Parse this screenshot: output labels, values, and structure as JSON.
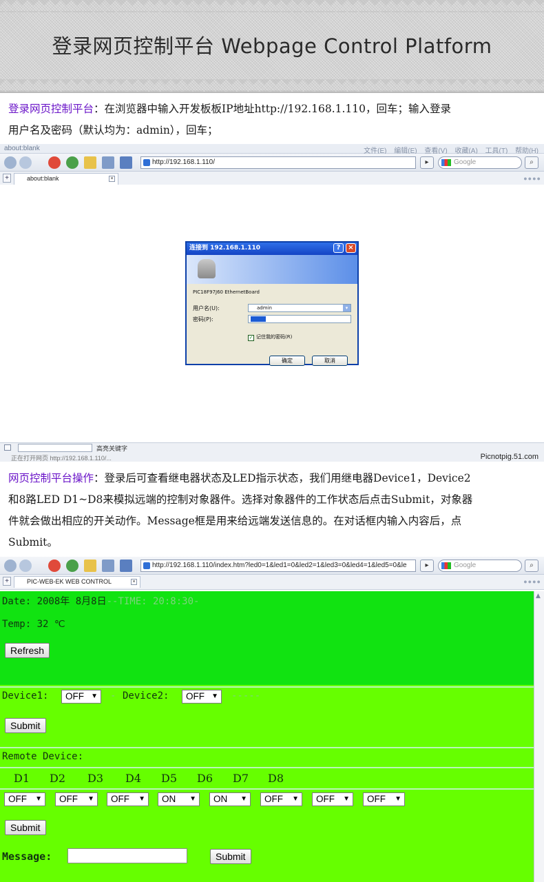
{
  "banner": {
    "title": "登录网页控制平台 Webpage Control Platform"
  },
  "para1": {
    "highlight": "登录网页控制平台",
    "line1_rest": "：在浏览器中输入开发板板IP地址http://192.168.1.110，回车；输入登录",
    "line2": "用户名及密码（默认均为：admin），回车；"
  },
  "browser1": {
    "tab_title": "about:blank",
    "menu": "文件(E) 编辑(E) 查看(V) 收藏(A) 工具(T) 帮助(H)",
    "address": "http://192.168.1.110/",
    "search_placeholder": "Google",
    "tab_label": "about:blank"
  },
  "login_dialog": {
    "title": "连接到 192.168.1.110",
    "server": "PIC18F97J60 EthernetBoard",
    "username_label": "用户名(U):",
    "username_value": "admin",
    "password_label": "密码(P):",
    "remember_label": "记住我的密码(R)",
    "ok_label": "确定",
    "cancel_label": "取消"
  },
  "statusbar": {
    "highlight_label": "高亮关键字",
    "opening": "正在打开网页 http://192.168.1.110/...",
    "watermark": "Picnotpig.51.com"
  },
  "para2": {
    "highlight": "网页控制平台操作",
    "line1_rest": "：登录后可查看继电器状态及LED指示状态，我们用继电器Device1，Device2",
    "line2": "和8路LED D1~D8来模拟远端的控制对象器件。选择对象器件的工作状态后点击Submit，对象器",
    "line3": "件就会做出相应的开关动作。Message框是用来给远端发送信息的。在对话框内输入内容后，点",
    "line4": "Submit。"
  },
  "browser2": {
    "address": "http://192.168.1.110/index.htm?led0=1&led1=0&led2=1&led3=0&led4=1&led5=0&le",
    "search_placeholder": "Google",
    "tab_label": "PIC-WEB-EK WEB CONTROL"
  },
  "control": {
    "date_line": "Date: 2008年 8月8日",
    "time_line": "--TIME: 20:8:30-",
    "temp_line": "Temp: 32 ℃",
    "refresh_label": "Refresh",
    "device1_label": "Device1:",
    "device1_value": "OFF",
    "sep_dash": "-",
    "device2_label": "Device2:",
    "device2_value": "OFF",
    "trail_dash": "-----",
    "submit_label": "Submit",
    "remote_label": "Remote Device:",
    "leds": [
      {
        "name": "D1",
        "state": "OFF"
      },
      {
        "name": "D2",
        "state": "OFF"
      },
      {
        "name": "D3",
        "state": "OFF"
      },
      {
        "name": "D4",
        "state": "ON"
      },
      {
        "name": "D5",
        "state": "ON"
      },
      {
        "name": "D6",
        "state": "OFF"
      },
      {
        "name": "D7",
        "state": "OFF"
      },
      {
        "name": "D8",
        "state": "OFF"
      }
    ],
    "submit2_label": "Submit",
    "message_label": "Message:",
    "message_value": "",
    "submit3_label": "Submit"
  }
}
